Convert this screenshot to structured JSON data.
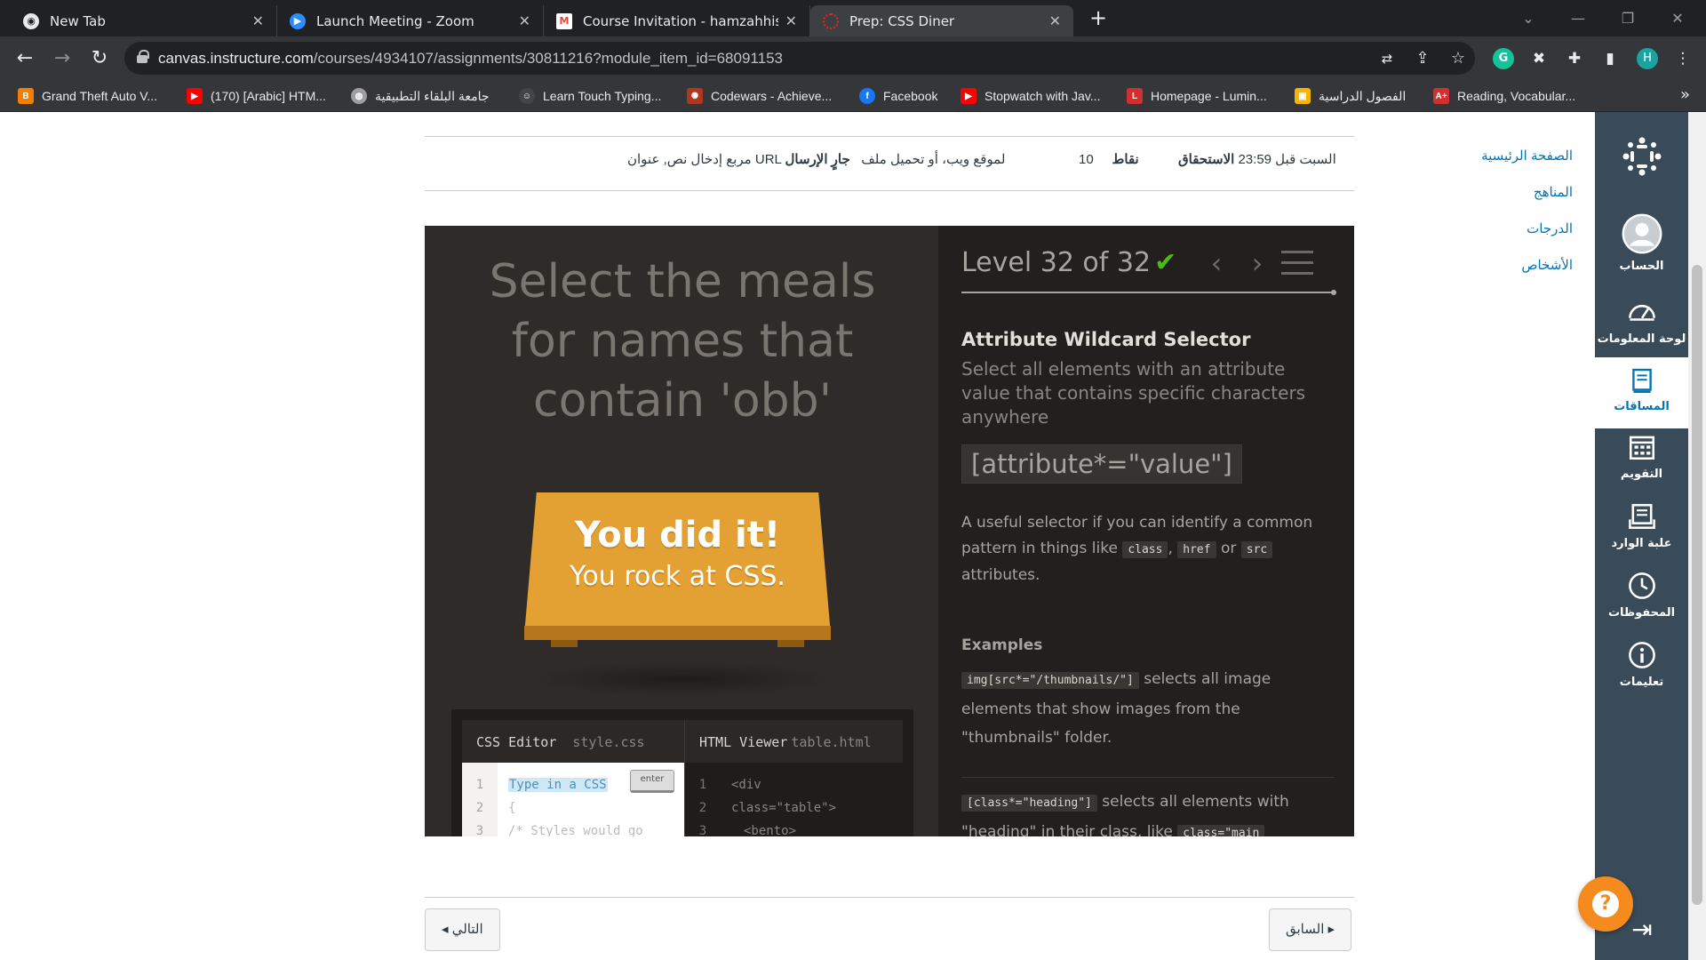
{
  "browser": {
    "tabs": [
      {
        "label": "New Tab",
        "icon": "chrome-icon",
        "active": false
      },
      {
        "label": "Launch Meeting - Zoom",
        "icon": "zoom-icon",
        "active": false
      },
      {
        "label": "Course Invitation - hamzahhishar",
        "icon": "gmail-icon",
        "active": false
      },
      {
        "label": "Prep: CSS Diner",
        "icon": "canvas-icon",
        "active": true
      }
    ],
    "new_tab": "+",
    "url_host": "canvas.instructure.com",
    "url_path": "/courses/4934107/assignments/30811216?module_item_id=68091153",
    "profile_initial": "H",
    "bookmarks": [
      {
        "label": "Grand Theft Auto V...",
        "icon": "blogger-icon",
        "color": "#f57d00"
      },
      {
        "label": "(170) [Arabic] HTM...",
        "icon": "youtube-icon",
        "color": "#ff0000"
      },
      {
        "label": "جامعة البلقاء التطبيقية",
        "icon": "university-icon",
        "color": "#9e9e9e"
      },
      {
        "label": "Learn Touch Typing...",
        "icon": "typing-icon",
        "color": "#444"
      },
      {
        "label": "Codewars - Achieve...",
        "icon": "codewars-icon",
        "color": "#b1361e"
      },
      {
        "label": "Facebook",
        "icon": "facebook-icon",
        "color": "#1877f2"
      },
      {
        "label": "Stopwatch with Jav...",
        "icon": "youtube-icon",
        "color": "#ff0000"
      },
      {
        "label": "Homepage - Lumin...",
        "icon": "ltuc-icon",
        "color": "#d32f2f"
      },
      {
        "label": "الفصول الدراسية",
        "icon": "classroom-icon",
        "color": "#f4b400"
      },
      {
        "label": "Reading, Vocabular...",
        "icon": "aplus-icon",
        "color": "#d32f2f"
      }
    ]
  },
  "global_nav": {
    "items": [
      {
        "label": "الحساب",
        "icon": "account-icon"
      },
      {
        "label": "لوحة المعلومات",
        "icon": "dashboard-icon"
      },
      {
        "label": "المساقات",
        "icon": "courses-icon"
      },
      {
        "label": "التقويم",
        "icon": "calendar-icon"
      },
      {
        "label": "علبة الوارد",
        "icon": "inbox-icon"
      },
      {
        "label": "المحفوظات",
        "icon": "history-icon"
      },
      {
        "label": "تعليمات",
        "icon": "help-info-icon"
      }
    ]
  },
  "course_nav": [
    "الصفحة الرئيسية",
    "المناهج",
    "الدرجات",
    "الأشخاص"
  ],
  "assignment": {
    "due_label": "الاستحقاق",
    "due_value": "السبت قبل 23:59",
    "points_label": "نقاط",
    "points_value": "10",
    "submitting_label": "جارٍ الإرسال",
    "submitting_value": "مربع إدخال نص, عنوان URL لموقع ويب، أو تحميل ملف"
  },
  "diner": {
    "instruction": "Select the meals for names that contain 'obb'",
    "win_title": "You did it!",
    "win_subtitle": "You rock at CSS.",
    "css_editor_label": "CSS Editor",
    "css_file": "style.css",
    "html_viewer_label": "HTML Viewer",
    "html_file": "table.html",
    "css_input_placeholder": "Type in a CSS",
    "enter_label": "enter",
    "css_lines": [
      "{",
      "/* Styles would go"
    ],
    "css_line_numbers": [
      "1",
      "2",
      "3"
    ],
    "html_lines": [
      "<div",
      "class=\"table\">",
      "  <bento>"
    ],
    "html_line_numbers": [
      "1",
      "2",
      "3"
    ],
    "level_text": "Level 32 of 32",
    "level_progress": 1.0,
    "check": "✔",
    "prev": "‹",
    "next": "›",
    "selector_title": "Attribute Wildcard Selector",
    "selector_desc": "Select all elements with an attribute value that contains specific characters anywhere",
    "syntax": "[attribute*=\"value\"]",
    "hint_1": "A useful selector if you can identify a common pattern in things like",
    "hint_code_1": "class",
    "hint_comma": ",",
    "hint_code_2": "href",
    "hint_or": "or",
    "hint_code_3": "src",
    "hint_2": "attributes.",
    "examples_label": "Examples",
    "example_1_code": "img[src*=\"/thumbnails/\"]",
    "example_1_text": "selects all image elements that show images from the \"thumbnails\" folder.",
    "example_2_code": "[class*=\"heading\"]",
    "example_2_text": "selects all elements with \"heading\" in their class, like",
    "example_2_code_b": "class=\"main"
  },
  "footer": {
    "next_label": "◂ التالي",
    "prev_label": "السابق ▸"
  },
  "colors": {
    "canvas_nav": "#394b58",
    "canvas_link": "#0374b5",
    "table": "#e3a033",
    "check": "#4cbb17",
    "help": "#f58b1f"
  }
}
